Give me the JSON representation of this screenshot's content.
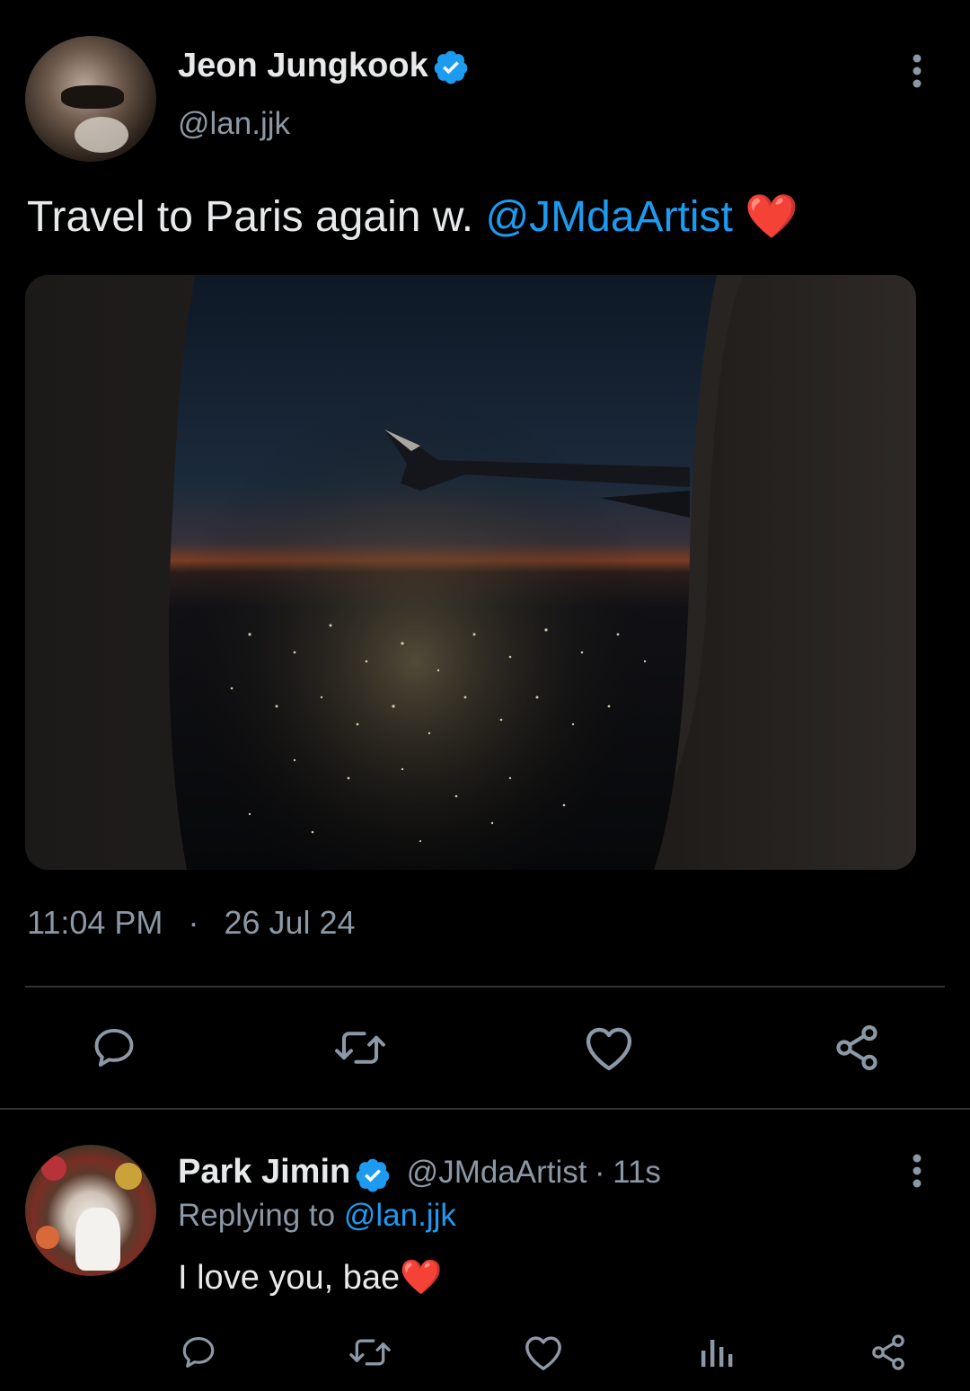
{
  "main_tweet": {
    "author_name": "Jeon Jungkook",
    "author_handle": "@lan.jjk",
    "text_prefix": "Travel to Paris again w. ",
    "mention": "@JMdaArtist",
    "emoji": "❤️",
    "time": "11:04 PM",
    "separator": "·",
    "date": "26 Jul 24",
    "icons": {
      "more": "more-vertical-icon",
      "verified": "verified-badge-icon",
      "reply": "reply-icon",
      "retweet": "retweet-icon",
      "like": "heart-icon",
      "share": "share-icon"
    }
  },
  "reply": {
    "author_name": "Park Jimin",
    "author_handle": "@JMdaArtist",
    "time_sep": "·",
    "time": "11s",
    "replying_prefix": "Replying to",
    "replying_handle": "@lan.jjk",
    "text": "I love you, bae",
    "emoji": "❤️",
    "icons": {
      "more": "more-vertical-icon",
      "reply": "reply-icon",
      "retweet": "retweet-icon",
      "like": "heart-icon",
      "analytics": "analytics-icon",
      "share": "share-icon"
    }
  },
  "colors": {
    "background": "#000000",
    "text": "#e7e9ea",
    "secondary": "#8b98a5",
    "accent": "#1d9bf0",
    "divider": "#2f3336",
    "heart": "#e0245e"
  }
}
